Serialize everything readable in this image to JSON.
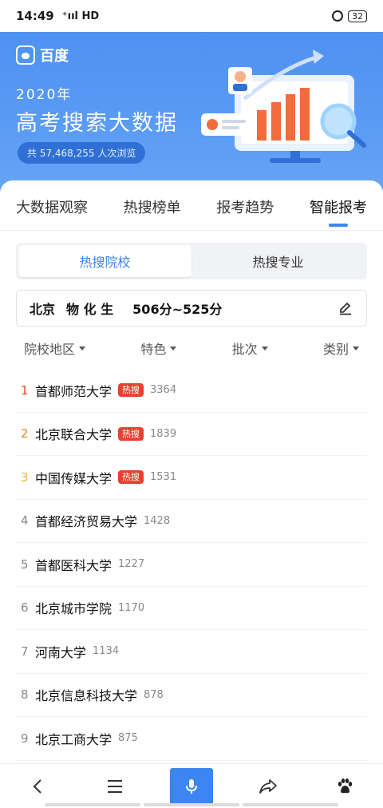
{
  "status": {
    "time": "14:49",
    "signal": "⁺ııl HD",
    "battery": "32"
  },
  "hero": {
    "logo": "百度",
    "year": "2020年",
    "title": "高考搜索大数据",
    "pill": "共 57,468,255 人次浏览"
  },
  "tabs": [
    "大数据观察",
    "热搜榜单",
    "报考趋势",
    "智能报考"
  ],
  "segment": [
    "热搜院校",
    "热搜专业"
  ],
  "filter": {
    "city": "北京",
    "subjects": "物 化 生",
    "range": "506分~525分"
  },
  "dropdowns": [
    "院校地区",
    "特色",
    "批次",
    "类别"
  ],
  "hot_badge": "热搜",
  "list": [
    {
      "rank": "1",
      "name": "首都师范大学",
      "hot": true,
      "count": "3364"
    },
    {
      "rank": "2",
      "name": "北京联合大学",
      "hot": true,
      "count": "1839"
    },
    {
      "rank": "3",
      "name": "中国传媒大学",
      "hot": true,
      "count": "1531"
    },
    {
      "rank": "4",
      "name": "首都经济贸易大学",
      "hot": false,
      "count": "1428"
    },
    {
      "rank": "5",
      "name": "首都医科大学",
      "hot": false,
      "count": "1227"
    },
    {
      "rank": "6",
      "name": "北京城市学院",
      "hot": false,
      "count": "1170"
    },
    {
      "rank": "7",
      "name": "河南大学",
      "hot": false,
      "count": "1134"
    },
    {
      "rank": "8",
      "name": "北京信息科技大学",
      "hot": false,
      "count": "878"
    },
    {
      "rank": "9",
      "name": "北京工商大学",
      "hot": false,
      "count": "875"
    }
  ],
  "colors": {
    "accent": "#3b86f0",
    "hot": "#e8412f",
    "rank2": "#f0821e",
    "rank3": "#f1b42a"
  },
  "bottom_icons": [
    "back-icon",
    "menu-icon",
    "mic-icon",
    "share-icon",
    "paw-icon"
  ]
}
